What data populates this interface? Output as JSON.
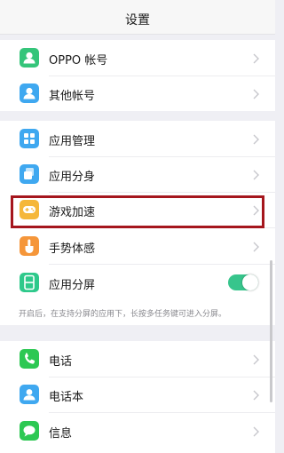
{
  "header": {
    "title": "设置"
  },
  "accounts": {
    "items": [
      {
        "label": "OPPO 帐号",
        "icon": "oppo-account-icon",
        "color": "#35c57a"
      },
      {
        "label": "其他帐号",
        "icon": "other-account-icon",
        "color": "#3fa8f0"
      }
    ]
  },
  "apps": {
    "items": [
      {
        "label": "应用管理",
        "icon": "app-management-icon",
        "color": "#3fa8f0"
      },
      {
        "label": "应用分身",
        "icon": "app-clone-icon",
        "color": "#3fa8f0"
      },
      {
        "label": "游戏加速",
        "icon": "game-boost-icon",
        "color": "#f5b73a"
      },
      {
        "label": "手势体感",
        "icon": "gesture-icon",
        "color": "#f5963a"
      },
      {
        "label": "应用分屏",
        "icon": "split-screen-icon",
        "color": "#2ec98b",
        "toggle_on": true
      }
    ],
    "note": "开启后，在支持分屏的应用下，长按多任务键可进入分屏。"
  },
  "communication": {
    "items": [
      {
        "label": "电话",
        "icon": "phone-icon",
        "color": "#2dc853"
      },
      {
        "label": "电话本",
        "icon": "contacts-icon",
        "color": "#3fa8f0"
      },
      {
        "label": "信息",
        "icon": "messages-icon",
        "color": "#2dc853"
      }
    ]
  },
  "colors": {
    "highlight": "#a5161d",
    "toggle_on": "#37c58c",
    "background": "#efeff4"
  }
}
